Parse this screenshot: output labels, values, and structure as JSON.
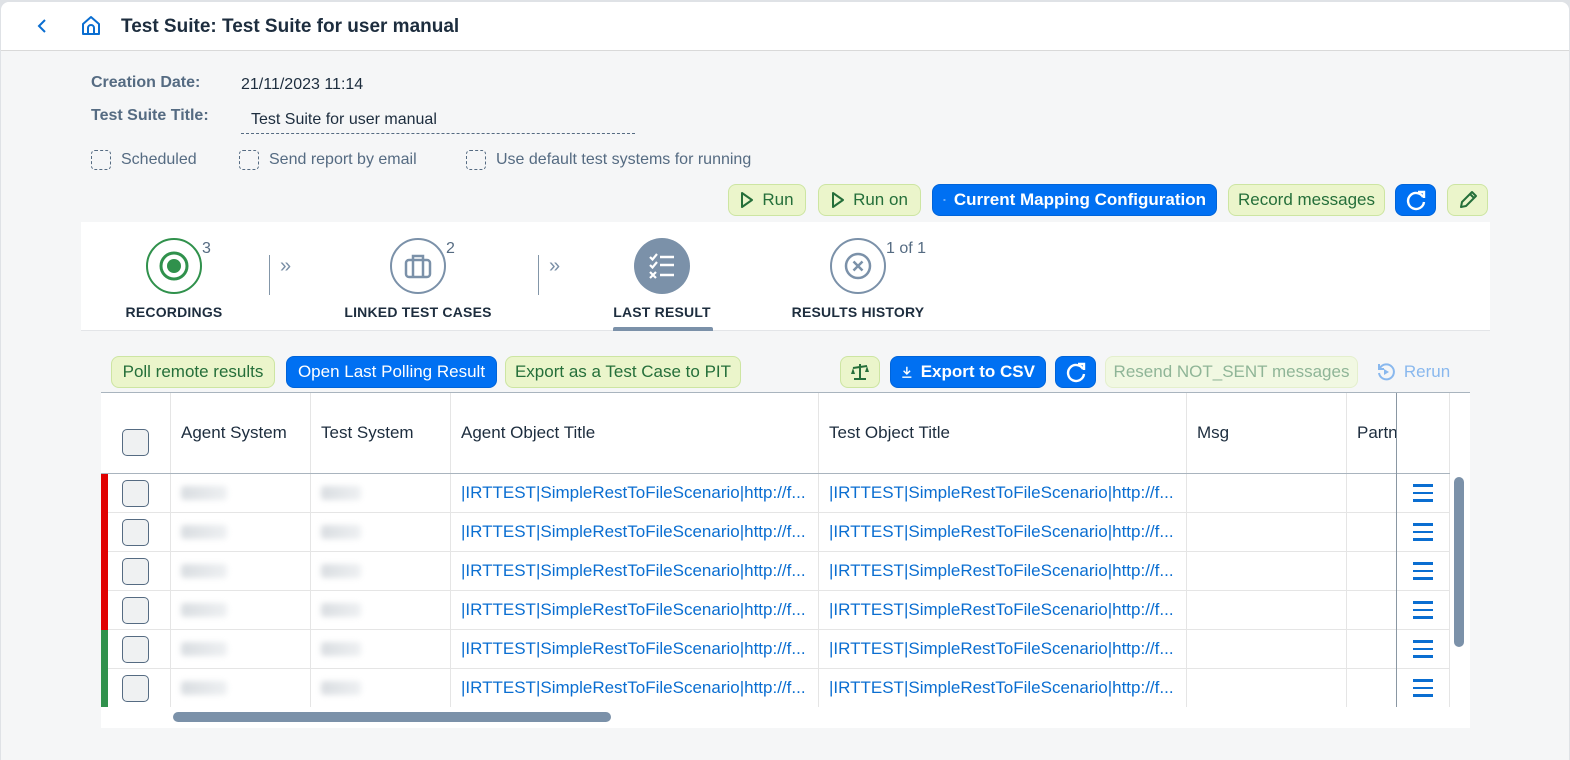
{
  "shellbar": {
    "title": "Test Suite: Test Suite for user manual",
    "back_icon": "chevron-left-icon",
    "home_icon": "home-icon"
  },
  "form": {
    "creation_date_label": "Creation Date:",
    "creation_date_value": "21/11/2023 11:14",
    "title_label": "Test Suite Title:",
    "title_value": "Test Suite for user manual",
    "checkboxes": [
      {
        "label": "Scheduled",
        "checked": false
      },
      {
        "label": "Send report by email",
        "checked": false
      },
      {
        "label": "Use default test systems for running",
        "checked": false
      }
    ]
  },
  "actions": {
    "run": "Run",
    "run_on": "Run on",
    "current_mapping": "Current Mapping Configuration",
    "record_messages": "Record messages",
    "refresh_icon": "refresh-icon",
    "edit_icon": "pencil-icon"
  },
  "process_flow": {
    "steps": [
      {
        "label": "RECORDINGS",
        "count": "3",
        "icon": "record-icon",
        "status": "positive"
      },
      {
        "label": "LINKED TEST CASES",
        "count": "2",
        "icon": "briefcase-icon",
        "status": "neutral"
      },
      {
        "label": "LAST RESULT",
        "count": "",
        "icon": "checklist-icon",
        "status": "selected"
      },
      {
        "label": "RESULTS HISTORY",
        "count": "1 of 1",
        "icon": "cancel-circle-icon",
        "status": "neutral"
      }
    ],
    "separator_icon": "double-chevron-right-icon"
  },
  "table_toolbar": {
    "poll_remote": "Poll remote results",
    "open_last_polling": "Open Last Polling Result",
    "export_pit": "Export as a Test Case to PIT",
    "compare_icon": "balance-scale-icon",
    "export_csv": "Export to CSV",
    "refresh_icon": "refresh-icon",
    "resend": "Resend NOT_SENT messages",
    "rerun": "Rerun"
  },
  "table": {
    "columns": [
      "Agent System",
      "Test System",
      "Agent Object Title",
      "Test Object Title",
      "Msg",
      "Partn"
    ],
    "colors": {
      "error": "#e00000",
      "success": "#30914c"
    },
    "rows": [
      {
        "status": "error",
        "agent_object": "|IRTTEST|SimpleRestToFileScenario|http://f...",
        "test_object": "|IRTTEST|SimpleRestToFileScenario|http://f...",
        "msg": "",
        "partn": ""
      },
      {
        "status": "error",
        "agent_object": "|IRTTEST|SimpleRestToFileScenario|http://f...",
        "test_object": "|IRTTEST|SimpleRestToFileScenario|http://f...",
        "msg": "",
        "partn": ""
      },
      {
        "status": "error",
        "agent_object": "|IRTTEST|SimpleRestToFileScenario|http://f...",
        "test_object": "|IRTTEST|SimpleRestToFileScenario|http://f...",
        "msg": "",
        "partn": ""
      },
      {
        "status": "error",
        "agent_object": "|IRTTEST|SimpleRestToFileScenario|http://f...",
        "test_object": "|IRTTEST|SimpleRestToFileScenario|http://f...",
        "msg": "",
        "partn": ""
      },
      {
        "status": "success",
        "agent_object": "|IRTTEST|SimpleRestToFileScenario|http://f...",
        "test_object": "|IRTTEST|SimpleRestToFileScenario|http://f...",
        "msg": "",
        "partn": ""
      },
      {
        "status": "success",
        "agent_object": "|IRTTEST|SimpleRestToFileScenario|http://f...",
        "test_object": "|IRTTEST|SimpleRestToFileScenario|http://f...",
        "msg": "",
        "partn": ""
      }
    ]
  }
}
